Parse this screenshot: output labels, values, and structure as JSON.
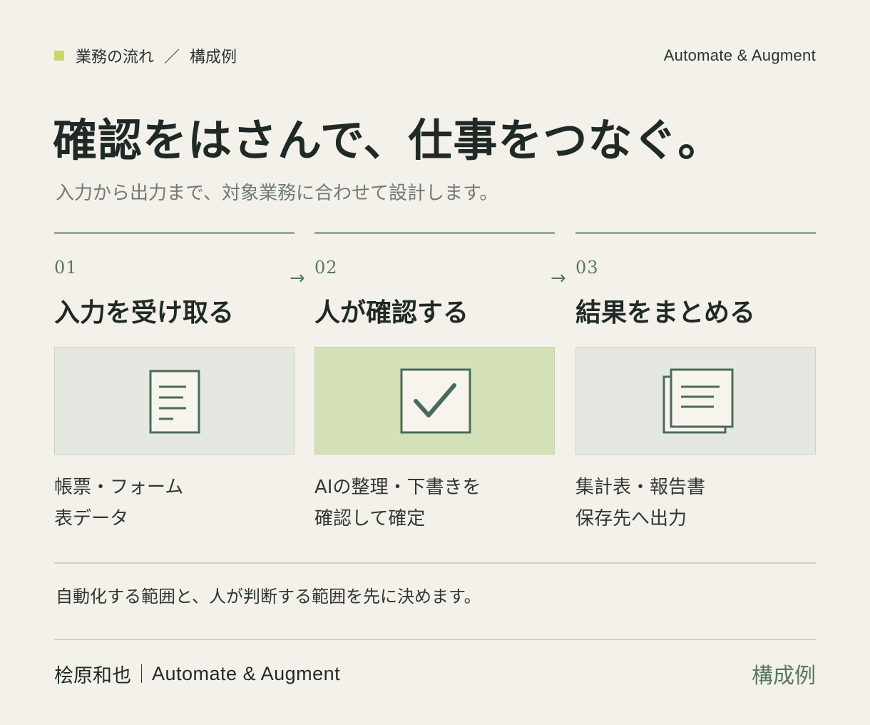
{
  "header": {
    "eyebrow_part1": "業務の流れ",
    "eyebrow_separator": "／",
    "eyebrow_part2": "構成例",
    "brand": "Automate & Augment",
    "accent_color": "#c6d86a"
  },
  "title": "確認をはさんで、仕事をつなぐ。",
  "subtitle": "入力から出力まで、対象業務に合わせて設計します。",
  "steps": [
    {
      "number": "01",
      "arrow": "",
      "title": "入力を受け取る",
      "icon": "document-icon",
      "desc_line1": "帳票・フォーム",
      "desc_line2": "表データ"
    },
    {
      "number": "02",
      "arrow": "→",
      "title": "人が確認する",
      "icon": "checkbox-icon",
      "desc_line1": "AIの整理・下書きを",
      "desc_line2": "確認して確定"
    },
    {
      "number": "03",
      "arrow": "→",
      "title": "結果をまとめる",
      "icon": "stacked-documents-icon",
      "desc_line1": "集計表・報告書",
      "desc_line2": "保存先へ出力"
    }
  ],
  "note": "自動化する範囲と、人が判断する範囲を先に決めます。",
  "footer": {
    "author": "桧原和也",
    "brand": "Automate & Augment",
    "label": "構成例"
  },
  "colors": {
    "background": "#f4f1ea",
    "icon_stroke": "#4a6b5b",
    "active_box": "#d4e0b8",
    "inactive_box": "#e5e8e0"
  }
}
